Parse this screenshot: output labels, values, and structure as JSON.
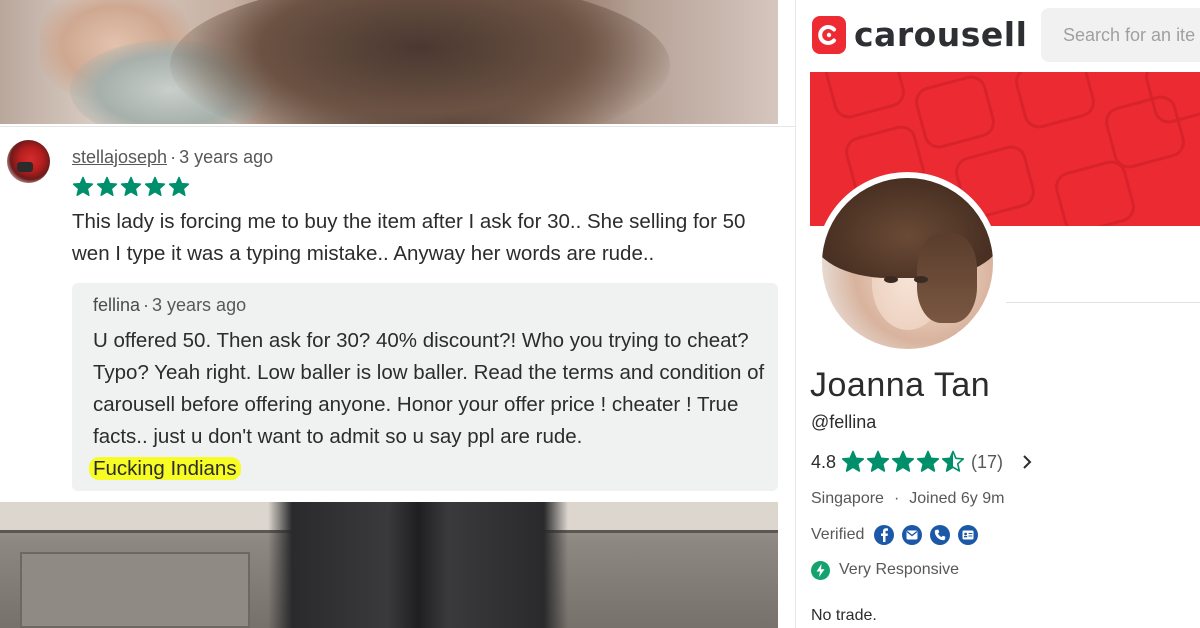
{
  "review": {
    "reviewer": "stellajoseph",
    "time": "3 years ago",
    "rating": 5,
    "text": "This lady is forcing me to buy the item after I ask for 30.. She selling for 50 wen I type it was a typing mistake.. Anyway her words are rude..",
    "reply": {
      "author": "fellina",
      "time": "3 years ago",
      "text": "U offered 50. Then ask for 30? 40% discount?! Who you trying to cheat? Typo? Yeah right. Low baller is low baller. Read the terms and condition of carousell before offering anyone. Honor your offer price ! cheater ! True facts.. just u don't want to admit so u say ppl are rude.",
      "highlighted_text": "Fucking Indians"
    }
  },
  "header": {
    "logo_text": "carousell",
    "search_placeholder": "Search for an ite"
  },
  "profile": {
    "name": "Joanna Tan",
    "handle": "@fellina",
    "rating": "4.8",
    "rating_stars": 4.5,
    "review_count": "(17)",
    "location": "Singapore",
    "joined": "Joined 6y 9m",
    "verified_label": "Verified",
    "verified_icons": [
      "facebook-icon",
      "email-icon",
      "phone-icon",
      "id-card-icon"
    ],
    "responsiveness": "Very Responsive",
    "bio": "No trade."
  },
  "colors": {
    "star_green": "#008f6b",
    "brand_red": "#ec2a32",
    "highlight_yellow": "#f6fc24",
    "verified_blue": "#1b58a8"
  }
}
